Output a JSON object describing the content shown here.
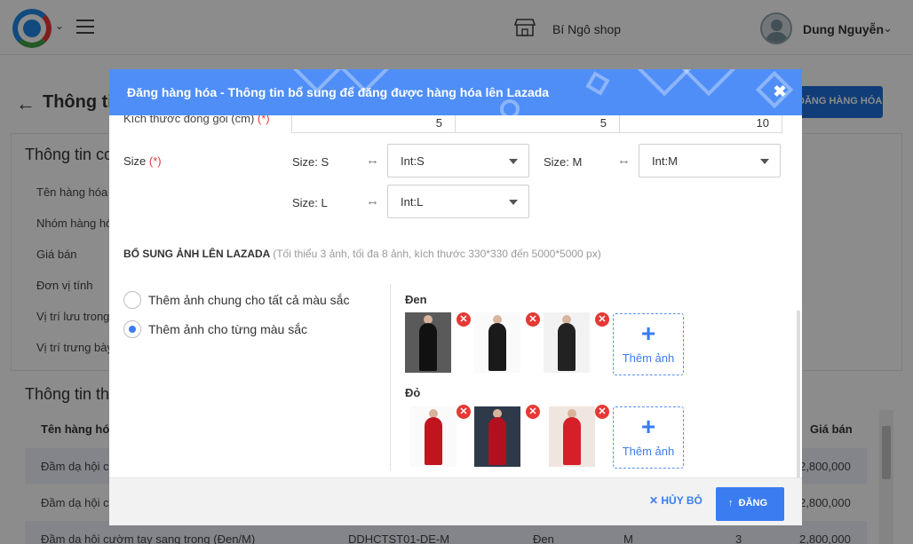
{
  "topbar": {
    "shop_name": "Bí Ngô shop",
    "user_name": "Dung Nguyễn"
  },
  "page": {
    "title": "Thông tin",
    "post_button": "ĐĂNG HÀNG HÓA",
    "card1_title": "Thông tin co",
    "fields": [
      "Tên hàng hóa",
      "Nhóm hàng hó",
      "Giá bán",
      "Đơn vị tính",
      "Vị trí lưu trong",
      "Vị trí trưng bày"
    ],
    "card2_title": "Thông tin th",
    "table_headers": {
      "name": "Tên hàng hóa",
      "price": "Giá bán"
    },
    "rows": [
      {
        "name": "Đầm dạ hội c",
        "price": "2,800,000"
      },
      {
        "name": "Đầm dạ hội c",
        "price": "2,800,000"
      },
      {
        "name": "Đầm dạ hội cườm tay sang trọng (Đen/M)",
        "code": "DDHCTST01-DE-M",
        "color": "Đen",
        "size": "M",
        "qty": "3",
        "price": "2,800,000"
      }
    ]
  },
  "modal": {
    "title": "Đăng hàng hóa - Thông tin bổ sung để đăng được hàng hóa lên Lazada",
    "package_label": "Kích thước đóng gói (cm) (*)",
    "package_values": [
      "5",
      "5",
      "10"
    ],
    "size_label": "Size",
    "required_mark": "(*)",
    "size_mappings": [
      {
        "key": "Size: S",
        "value": "Int:S"
      },
      {
        "key": "Size: M",
        "value": "Int:M"
      },
      {
        "key": "Size: L",
        "value": "Int:L"
      }
    ],
    "image_section_title": "BỔ SUNG ẢNH LÊN LAZADA",
    "image_section_hint": "(Tối thiểu 3 ảnh, tối đa 8 ảnh, kích thước 330*330 đến 5000*5000 px)",
    "radio_options": [
      {
        "label": "Thêm ảnh chung cho tất cả màu sắc",
        "checked": false
      },
      {
        "label": "Thêm ảnh cho từng màu sắc",
        "checked": true
      }
    ],
    "color_groups": [
      {
        "name": "Đen",
        "add_label": "Thêm ảnh"
      },
      {
        "name": "Đỏ",
        "add_label": "Thêm ảnh"
      }
    ],
    "cancel_label": "HỦY BỎ",
    "submit_label": "ĐĂNG"
  },
  "colors": {
    "accent": "#3b7cf0",
    "header": "#4f8ef7",
    "delete": "#e53935"
  }
}
